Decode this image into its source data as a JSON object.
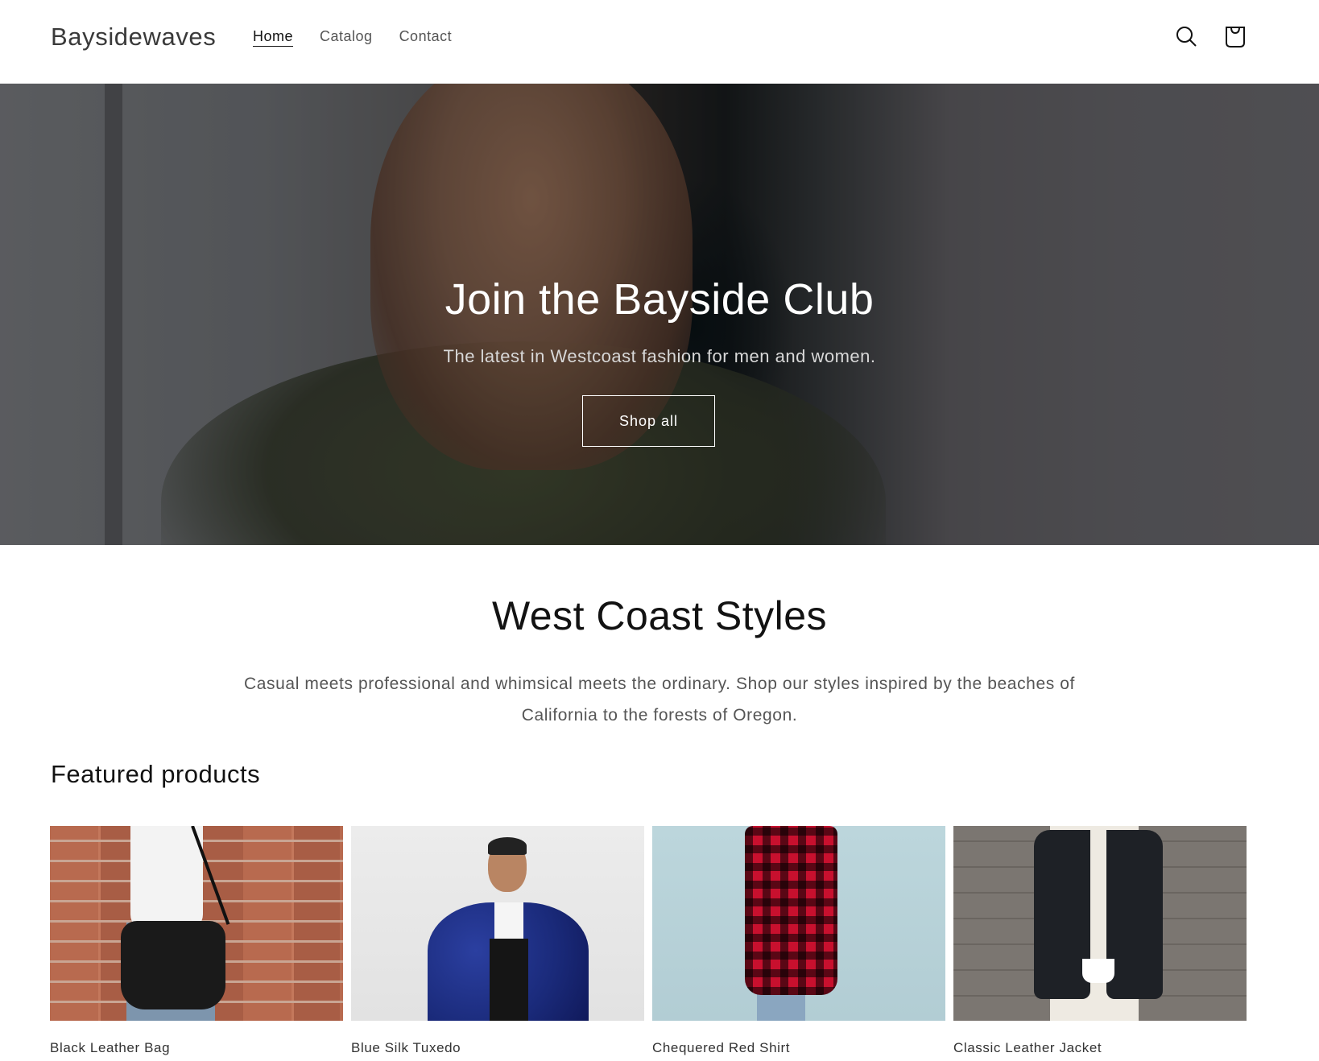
{
  "header": {
    "logo": "Baysidewaves",
    "nav": [
      {
        "label": "Home",
        "active": true
      },
      {
        "label": "Catalog",
        "active": false
      },
      {
        "label": "Contact",
        "active": false
      }
    ],
    "icons": {
      "search": "search-icon",
      "cart": "cart-icon"
    }
  },
  "hero": {
    "title": "Join the Bayside Club",
    "subtitle": "The latest in Westcoast fashion for men and women.",
    "button_label": "Shop all"
  },
  "rich_text": {
    "title": "West Coast Styles",
    "body": "Casual meets professional and whimsical meets the ordinary. Shop our styles inspired by the beaches of California to the forests of Oregon."
  },
  "featured": {
    "title": "Featured products",
    "products": [
      {
        "title": "Black Leather Bag"
      },
      {
        "title": "Blue Silk Tuxedo"
      },
      {
        "title": "Chequered Red Shirt"
      },
      {
        "title": "Classic Leather Jacket"
      }
    ]
  }
}
